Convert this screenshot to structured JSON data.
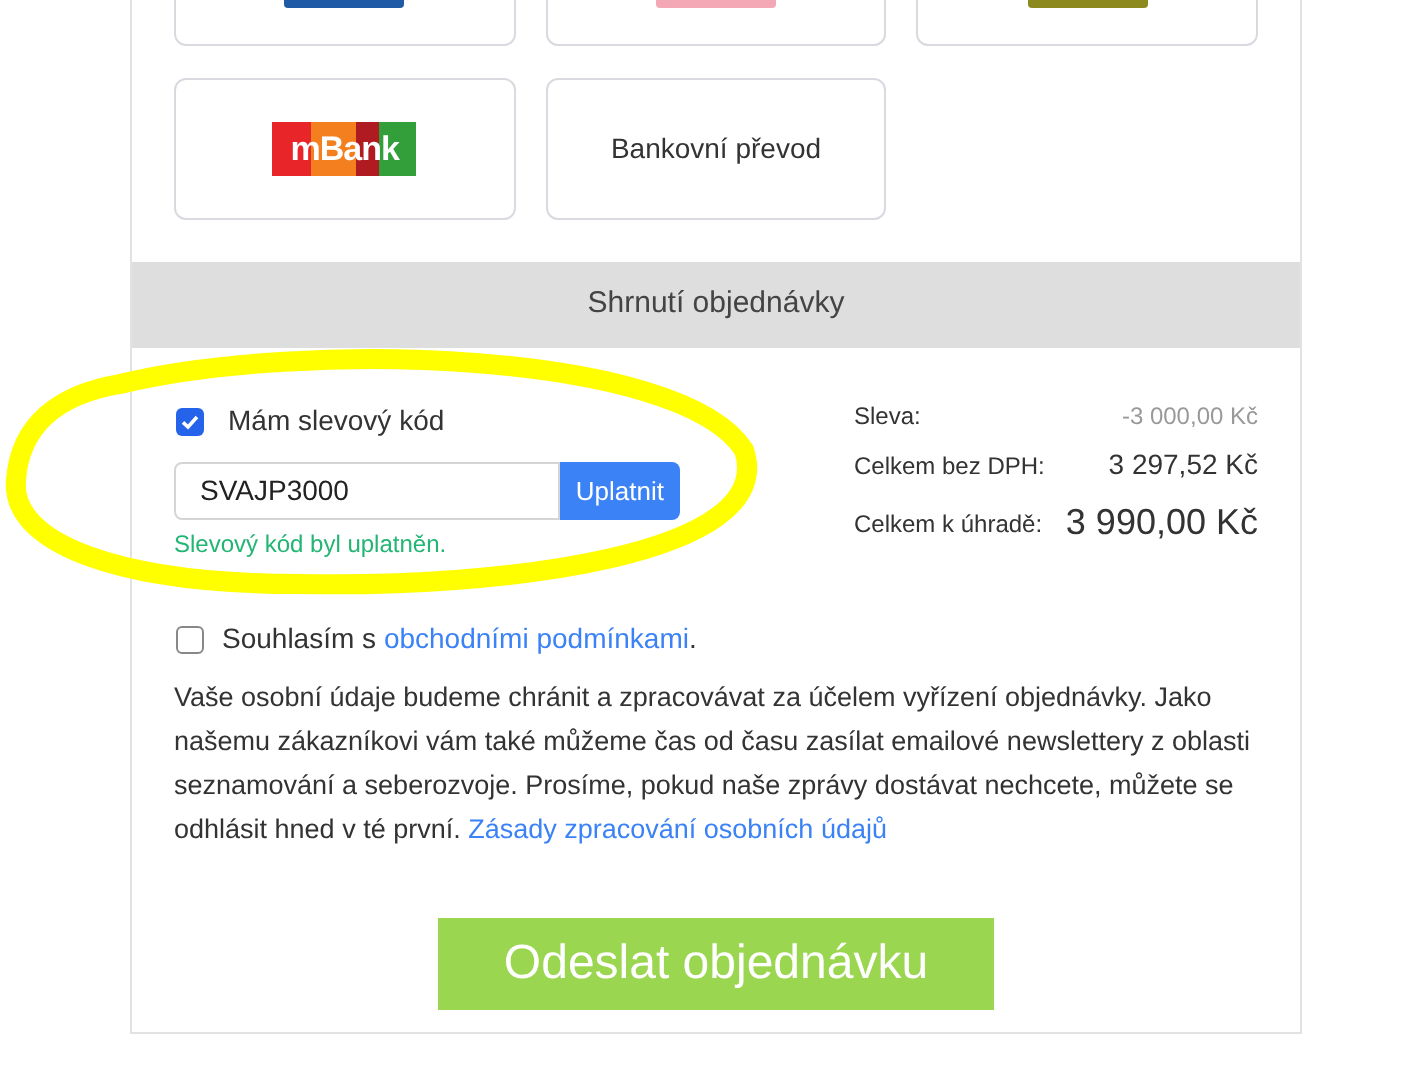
{
  "payment_methods": [
    {
      "kind": "cut_logo",
      "color": "#1f5aa6"
    },
    {
      "kind": "cut_logo",
      "color": "#f4a7b4"
    },
    {
      "kind": "cut_logo",
      "color": "#8c8a1e"
    },
    {
      "kind": "mbank",
      "label": "mBank"
    },
    {
      "kind": "text",
      "label": "Bankovní převod"
    }
  ],
  "summary": {
    "title": "Shrnutí objednávky",
    "discount": {
      "checked": true,
      "label": "Mám slevový kód",
      "value": "SVAJP3000",
      "button": "Uplatnit",
      "message": "Slevový kód byl uplatněn."
    },
    "totals": [
      {
        "kind": "discount",
        "label": "Sleva:",
        "value": "-3 000,00 Kč"
      },
      {
        "kind": "normal",
        "label": "Celkem bez DPH:",
        "value": "3 297,52 Kč"
      },
      {
        "kind": "grand",
        "label": "Celkem k úhradě:",
        "value": "3 990,00 Kč"
      }
    ]
  },
  "terms": {
    "checked": false,
    "text": "Souhlasím s ",
    "link": "obchodními podmínkami",
    "suffix": "."
  },
  "privacy": {
    "text": "Vaše osobní údaje budeme chránit a zpracovávat za účelem vyřízení objednávky. Jako našemu zákazníkovi vám také můžeme čas od času zasílat emailové newslettery z oblasti seznamování a seberozvoje. Prosíme, pokud naše zprávy dostávat nechcete, můžete se odhlásit hned v té první. ",
    "link": "Zásady zpracování osobních údajů"
  },
  "submit": "Odeslat objednávku"
}
